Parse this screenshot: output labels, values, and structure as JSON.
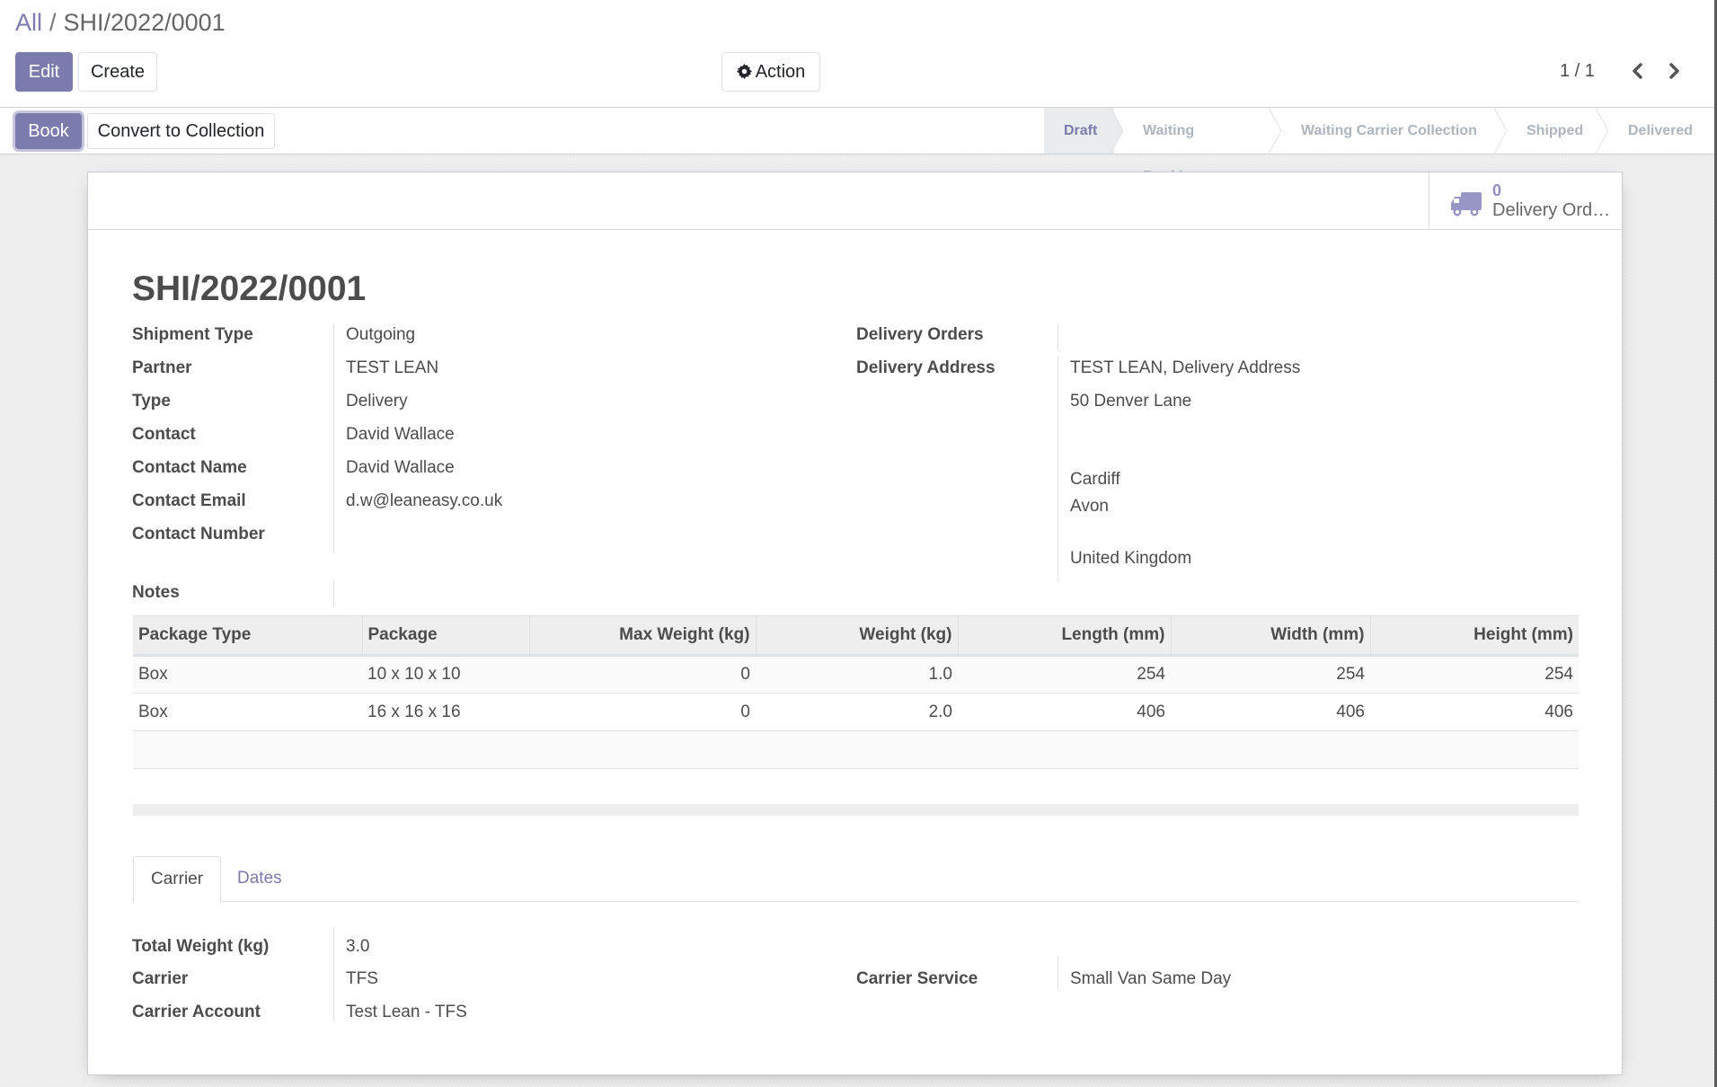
{
  "breadcrumb": {
    "root": "All",
    "separator": "/",
    "current": "SHI/2022/0001"
  },
  "toolbar": {
    "edit_label": "Edit",
    "create_label": "Create",
    "action_label": "Action",
    "action_icon": "gear-icon"
  },
  "pager": {
    "value": "1 / 1",
    "prev_icon": "chevron-left-icon",
    "next_icon": "chevron-right-icon"
  },
  "header_buttons": {
    "book_label": "Book",
    "convert_label": "Convert to Collection"
  },
  "statusbar": {
    "steps": [
      {
        "label": "Draft",
        "active": true
      },
      {
        "label": "Waiting Booking",
        "active": false
      },
      {
        "label": "Waiting Carrier Collection",
        "active": false
      },
      {
        "label": "Shipped",
        "active": false
      },
      {
        "label": "Delivered",
        "active": false
      }
    ]
  },
  "stat_button": {
    "icon": "truck-icon",
    "value": "0",
    "label": "Delivery Ord…"
  },
  "record": {
    "title": "SHI/2022/0001",
    "left_fields": [
      {
        "label": "Shipment Type",
        "value": "Outgoing"
      },
      {
        "label": "Partner",
        "value": "TEST LEAN"
      },
      {
        "label": "Type",
        "value": "Delivery"
      },
      {
        "label": "Contact",
        "value": "David Wallace"
      },
      {
        "label": "Contact Name",
        "value": "David Wallace"
      },
      {
        "label": "Contact Email",
        "value": "d.w@leaneasy.co.uk"
      },
      {
        "label": "Contact Number",
        "value": ""
      }
    ],
    "right_fields": {
      "delivery_orders_label": "Delivery Orders",
      "delivery_orders_value": "",
      "delivery_address_label": "Delivery Address",
      "address_lines": [
        "TEST LEAN, Delivery Address",
        "50 Denver Lane",
        "",
        "Cardiff",
        "Avon",
        "",
        "United Kingdom"
      ]
    },
    "notes_label": "Notes",
    "notes_value": ""
  },
  "packages_table": {
    "columns": [
      "Package Type",
      "Package",
      "Max Weight (kg)",
      "Weight (kg)",
      "Length (mm)",
      "Width (mm)",
      "Height (mm)"
    ],
    "rows": [
      [
        "Box",
        "10 x 10 x 10",
        "0",
        "1.0",
        "254",
        "254",
        "254"
      ],
      [
        "Box",
        "16 x 16 x 16",
        "0",
        "2.0",
        "406",
        "406",
        "406"
      ]
    ]
  },
  "tabs": [
    {
      "label": "Carrier",
      "active": true
    },
    {
      "label": "Dates",
      "active": false
    }
  ],
  "carrier": {
    "total_weight_label": "Total Weight (kg)",
    "total_weight_value": "3.0",
    "carrier_label": "Carrier",
    "carrier_value": "TFS",
    "carrier_account_label": "Carrier Account",
    "carrier_account_value": "Test Lean - TFS",
    "carrier_service_label": "Carrier Service",
    "carrier_service_value": "Small Van Same Day"
  },
  "colors": {
    "accent": "#7c7bad",
    "stat_value": "#8f8dc0",
    "status_inactive": "#adb5bd",
    "text": "#4c4c4c"
  }
}
